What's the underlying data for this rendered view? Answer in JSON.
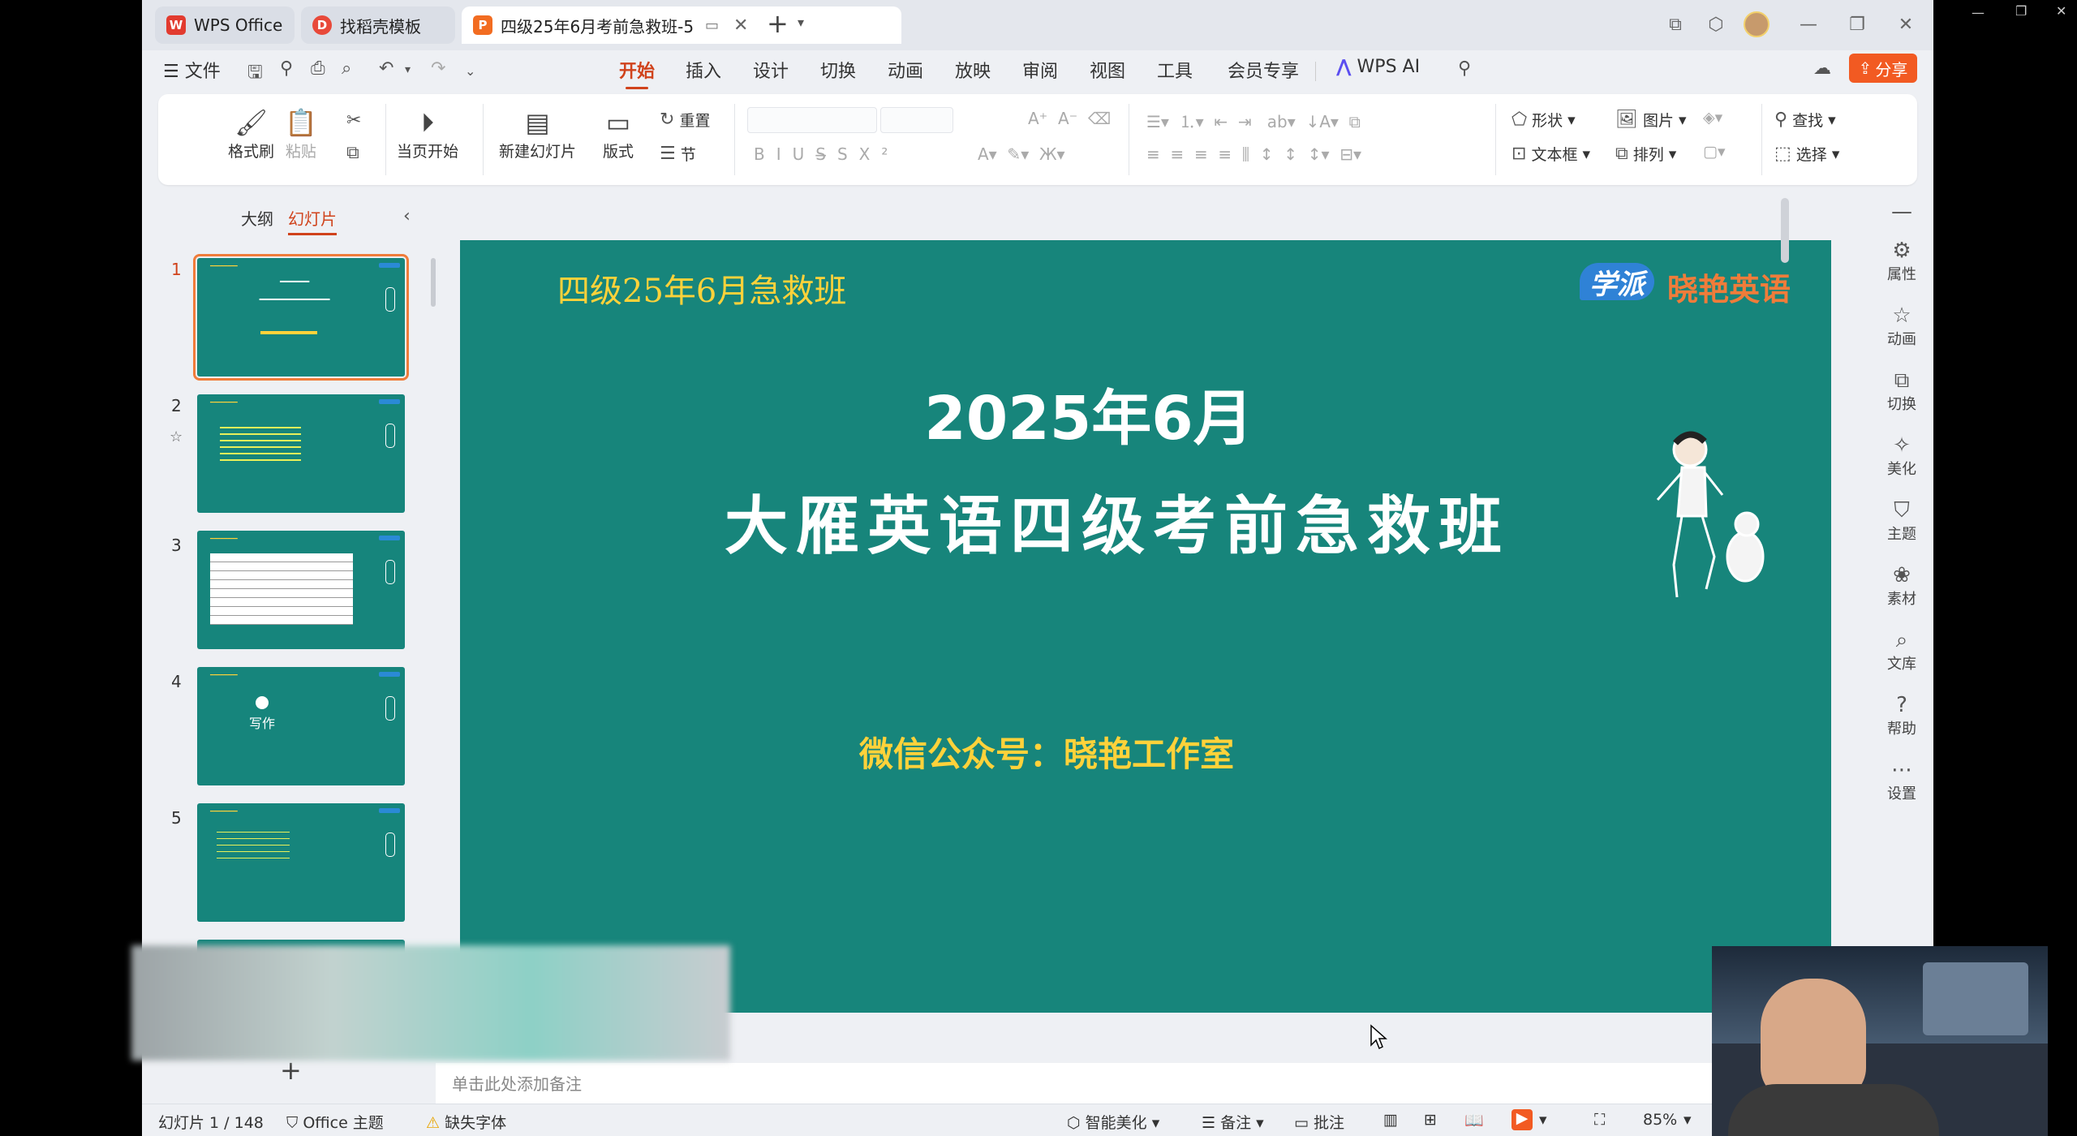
{
  "tabs": [
    {
      "label": "WPS Office",
      "icon": "wps-logo-icon"
    },
    {
      "label": "找稻壳模板",
      "icon": "docer-icon"
    },
    {
      "label": "四级25年6月考前急救班-5.",
      "icon": "ppt-file-icon"
    }
  ],
  "menu": {
    "file": "文件",
    "items": [
      "开始",
      "插入",
      "设计",
      "切换",
      "动画",
      "放映",
      "审阅",
      "视图",
      "工具",
      "会员专享"
    ],
    "active": "开始",
    "wps_ai": "WPS AI",
    "share": "分享"
  },
  "ribbon": {
    "format_painter": "格式刷",
    "paste": "粘贴",
    "play_current": "当页开始",
    "new_slide": "新建幻灯片",
    "layout": "版式",
    "reset": "重置",
    "section": "节",
    "shape": "形状",
    "picture": "图片",
    "textbox": "文本框",
    "arrange": "排列",
    "find": "查找",
    "select": "选择"
  },
  "left_panel": {
    "outline_tab": "大纲",
    "slides_tab": "幻灯片",
    "slide_numbers": [
      "1",
      "2",
      "3",
      "4",
      "5"
    ],
    "thumb4_text": "写作"
  },
  "slide": {
    "top_title": "四级25年6月急救班",
    "logo_mark": "学派",
    "logo_text": "晓艳英语",
    "date": "2025年6月",
    "title": "大雁英语四级考前急救班",
    "wechat": "微信公众号：晓艳工作室",
    "bg_color": "#17857b"
  },
  "notes": {
    "placeholder": "单击此处添加备注"
  },
  "right_sidebar": [
    "属性",
    "动画",
    "切换",
    "美化",
    "主题",
    "素材",
    "文库",
    "帮助",
    "设置"
  ],
  "status": {
    "slide_count": "幻灯片 1 / 148",
    "theme": "Office 主题",
    "missing_font": "缺失字体",
    "smart_beautify": "智能美化",
    "notes": "备注",
    "comments": "批注",
    "zoom": "85%"
  }
}
